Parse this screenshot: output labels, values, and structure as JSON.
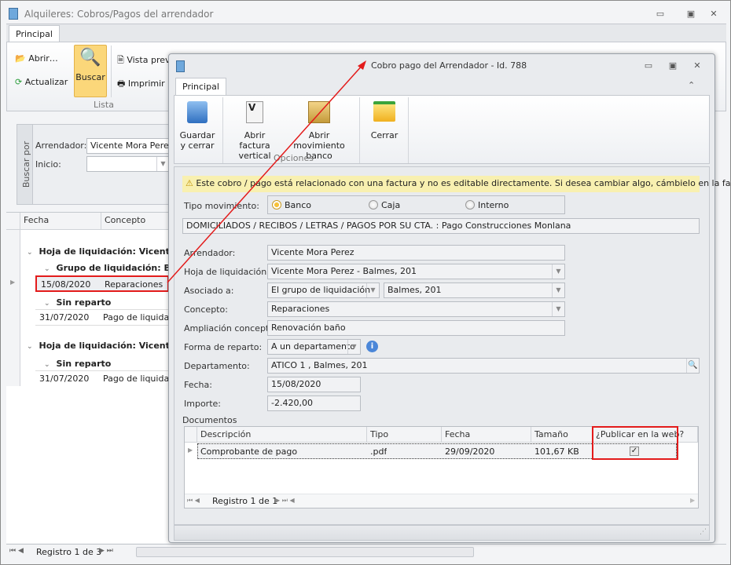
{
  "main_window": {
    "title": "Alquileres: Cobros/Pagos del arrendador",
    "tab": "Principal",
    "ribbon": {
      "abrir": "Abrir…",
      "actualizar": "Actualizar",
      "buscar": "Buscar",
      "vista_previa": "Vista prev",
      "imprimir": "Imprimir",
      "group_lista": "Lista"
    },
    "search": {
      "panel_label": "Buscar por",
      "arrendador_label": "Arrendador:",
      "arrendador_value": "Vicente Mora Perez",
      "inicio_label": "Inicio:",
      "inicio_value": ""
    },
    "grid": {
      "columns": [
        "Fecha",
        "Concepto"
      ],
      "group1": "Hoja de liquidación: Vicente M",
      "group1_sub1": "Grupo de liquidación: Balm",
      "row1": {
        "fecha": "15/08/2020",
        "concepto": "Reparaciones"
      },
      "group1_sub2": "Sin reparto",
      "row2": {
        "fecha": "31/07/2020",
        "concepto": "Pago de liquidació"
      },
      "group2": "Hoja de liquidación: Vicente M",
      "group2_sub1": "Sin reparto",
      "row3": {
        "fecha": "31/07/2020",
        "concepto": "Pago de liquidació"
      }
    },
    "nav": "Registro 1 de 3"
  },
  "dialog": {
    "title": "Cobro pago del Arrendador - Id. 788",
    "tab": "Principal",
    "ribbon": {
      "guardar": [
        "Guardar",
        "y cerrar"
      ],
      "abrir_factura": [
        "Abrir factura",
        "vertical"
      ],
      "abrir_mov": [
        "Abrir movimiento",
        "banco"
      ],
      "cerrar": "Cerrar",
      "group_opciones": "Opciones"
    },
    "warning": "Este cobro / pago está relacionado con una factura y no es editable directamente. Si desea cambiar algo, cámbielo en la factura.",
    "tipo_movimiento": {
      "label": "Tipo movimiento:",
      "options": [
        "Banco",
        "Caja",
        "Interno"
      ],
      "selected": "Banco"
    },
    "concept_line": "DOMICILIADOS / RECIBOS / LETRAS / PAGOS POR SU CTA. : Pago Construcciones Monlana",
    "fields": {
      "arrendador": {
        "label": "Arrendador:",
        "value": "Vicente Mora Perez"
      },
      "hoja": {
        "label": "Hoja de liquidación:",
        "value": "Vicente Mora Perez - Balmes, 201"
      },
      "asociado": {
        "label": "Asociado a:",
        "value": "El grupo de liquidación",
        "value2": "Balmes, 201"
      },
      "concepto": {
        "label": "Concepto:",
        "value": "Reparaciones"
      },
      "ampliacion": {
        "label": "Ampliación concepto:",
        "value": "Renovación baño"
      },
      "forma": {
        "label": "Forma de reparto:",
        "value": "A un departamento"
      },
      "departamento": {
        "label": "Departamento:",
        "value": "ATICO 1 , Balmes, 201"
      },
      "fecha": {
        "label": "Fecha:",
        "value": "15/08/2020"
      },
      "importe": {
        "label": "Importe:",
        "value": "-2.420,00"
      }
    },
    "documentos": {
      "label": "Documentos",
      "columns": [
        "Descripción",
        "Tipo",
        "Fecha",
        "Tamaño",
        "¿Publicar en la web?"
      ],
      "rows": [
        {
          "descripcion": "Comprobante de pago",
          "tipo": ".pdf",
          "fecha": "29/09/2020",
          "tamano": "101,67 KB",
          "publicar": true
        }
      ],
      "nav": "Registro 1 de 1"
    }
  },
  "colors": {
    "highlight": "#e31b1b",
    "accent": "#f7d774"
  }
}
